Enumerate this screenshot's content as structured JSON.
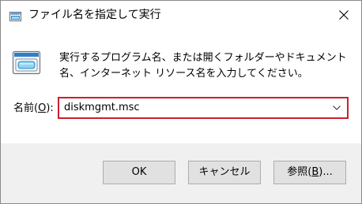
{
  "window": {
    "title": "ファイル名を指定して実行"
  },
  "dialog": {
    "description": "実行するプログラム名、または開くフォルダーやドキュメント名、インターネット リソース名を入力してください。",
    "open_label": {
      "prefix": "名前(",
      "access_key": "O",
      "suffix": "):"
    },
    "input_value": "diskmgmt.msc"
  },
  "buttons": {
    "ok": "OK",
    "cancel": "キャンセル",
    "browse": {
      "prefix": "参照(",
      "access_key": "B",
      "suffix": ")..."
    }
  },
  "icons": {
    "title": "run-dialog-icon",
    "close": "close-icon",
    "main": "run-program-icon",
    "dropdown": "chevron-down-icon"
  },
  "colors": {
    "highlight_border": "#cc1f2e",
    "footer_background": "#f0f0f0",
    "icon_blue": "#1e88c8"
  }
}
